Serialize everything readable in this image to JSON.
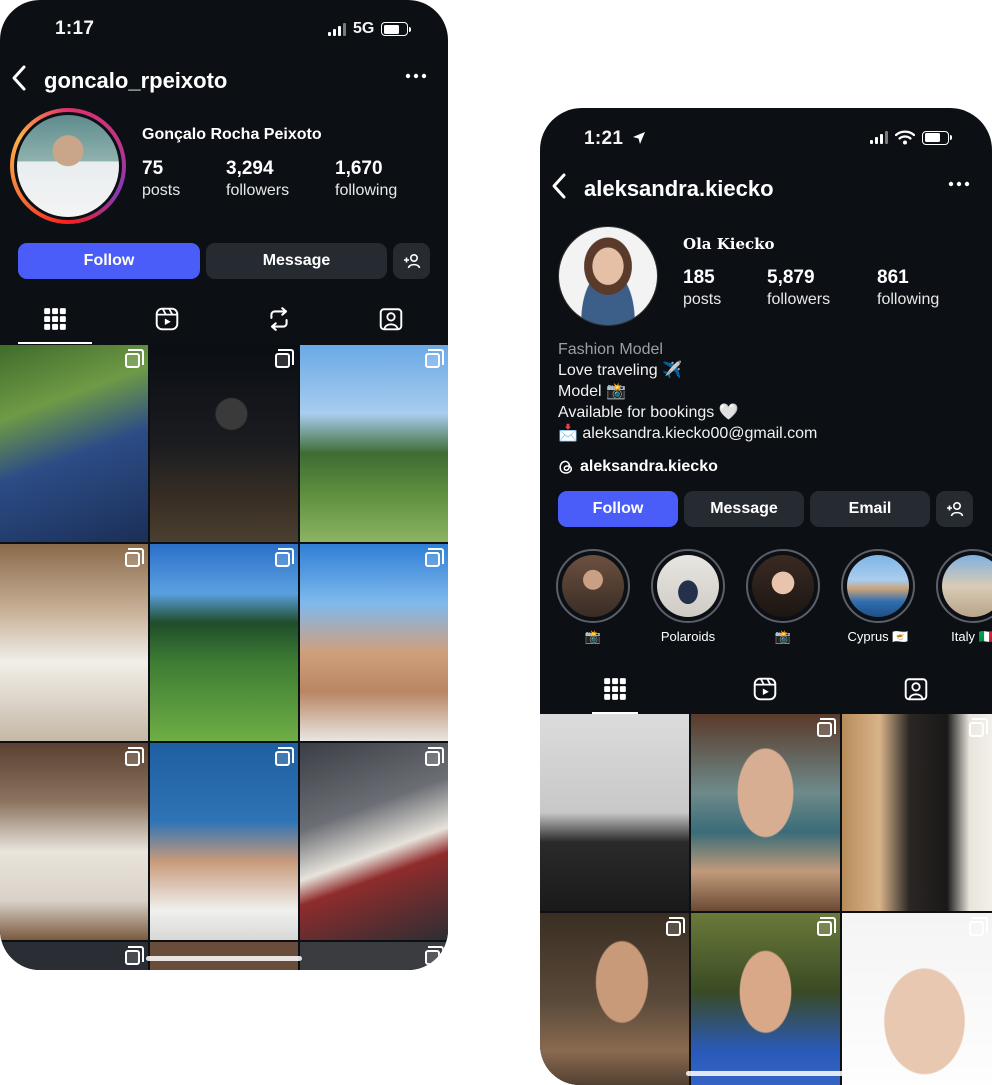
{
  "phone1": {
    "status": {
      "time": "1:17",
      "network": "5G"
    },
    "header": {
      "username": "goncalo_rpeixoto",
      "back_icon": "chevron-left-icon",
      "more_icon": "more-icon"
    },
    "profile": {
      "full_name": "Gonçalo Rocha Peixoto",
      "stats": [
        {
          "value": "75",
          "label": "posts"
        },
        {
          "value": "3,294",
          "label": "followers"
        },
        {
          "value": "1,670",
          "label": "following"
        }
      ]
    },
    "buttons": {
      "follow": "Follow",
      "message": "Message"
    },
    "colors": {
      "accent": "#4a5df9",
      "background": "#0c0f14"
    },
    "grid_count": 10
  },
  "phone2": {
    "status": {
      "time": "1:21"
    },
    "header": {
      "username": "aleksandra.kiecko",
      "back_icon": "chevron-left-icon",
      "more_icon": "more-icon"
    },
    "profile": {
      "full_name": "Ola Kiecko",
      "stats": [
        {
          "value": "185",
          "label": "posts"
        },
        {
          "value": "5,879",
          "label": "followers"
        },
        {
          "value": "861",
          "label": "following"
        }
      ],
      "bio": {
        "category": "Fashion Model",
        "line1": "Love traveling ✈️",
        "line2": "Model 📸",
        "line3": "Available for bookings 🤍",
        "email": "📩 aleksandra.kiecko00@gmail.com"
      },
      "threads_handle": "aleksandra.kiecko"
    },
    "buttons": {
      "follow": "Follow",
      "message": "Message",
      "email": "Email"
    },
    "highlights": [
      {
        "label": "📸"
      },
      {
        "label": "Polaroids"
      },
      {
        "label": "📸"
      },
      {
        "label": "Cyprus 🇨🇾"
      },
      {
        "label": "Italy 🇮🇹"
      }
    ]
  }
}
